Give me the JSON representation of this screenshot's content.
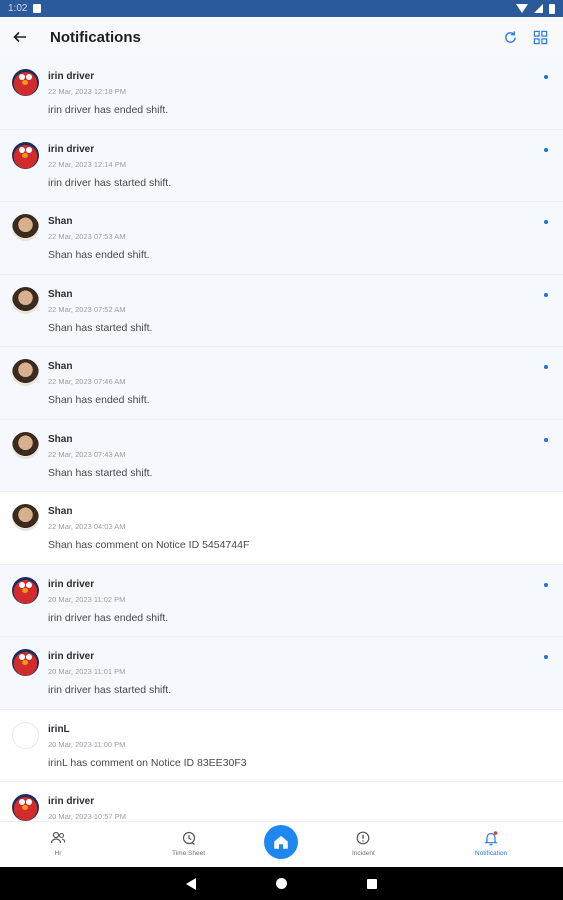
{
  "status_bar": {
    "time": "1:02"
  },
  "app_bar": {
    "title": "Notifications"
  },
  "notifications": [
    {
      "name": "irin driver",
      "date": "22 Mar, 2023 12:18 PM",
      "message": "irin driver has ended shift.",
      "avatar": "elmo",
      "unread": true
    },
    {
      "name": "irin driver",
      "date": "22 Mar, 2023 12:14 PM",
      "message": "irin driver has started shift.",
      "avatar": "elmo",
      "unread": true
    },
    {
      "name": "Shan",
      "date": "22 Mar, 2023 07:53 AM",
      "message": "Shan has ended shift.",
      "avatar": "shan",
      "unread": true
    },
    {
      "name": "Shan",
      "date": "22 Mar, 2023 07:52 AM",
      "message": "Shan has started shift.",
      "avatar": "shan",
      "unread": true
    },
    {
      "name": "Shan",
      "date": "22 Mar, 2023 07:46 AM",
      "message": "Shan has ended shift.",
      "avatar": "shan",
      "unread": true
    },
    {
      "name": "Shan",
      "date": "22 Mar, 2023 07:43 AM",
      "message": "Shan has started shift.",
      "avatar": "shan",
      "unread": true
    },
    {
      "name": "Shan",
      "date": "22 Mar, 2023 04:03 AM",
      "message": "Shan has comment on Notice ID 5454744F",
      "avatar": "shan",
      "unread": false
    },
    {
      "name": "irin driver",
      "date": "20 Mar, 2023 11:02 PM",
      "message": "irin driver has ended shift.",
      "avatar": "elmo",
      "unread": true
    },
    {
      "name": "irin driver",
      "date": "20 Mar, 2023 11:01 PM",
      "message": "irin driver has started shift.",
      "avatar": "elmo",
      "unread": true
    },
    {
      "name": "irinL",
      "date": "20 Mar, 2023 11:00 PM",
      "message": "irinL has comment on Notice ID 83EE30F3",
      "avatar": "blank",
      "unread": false
    },
    {
      "name": "irin driver",
      "date": "20 Mar, 2023 10:57 PM",
      "message": "",
      "avatar": "elmo",
      "unread": false
    }
  ],
  "bottom_nav": {
    "items": [
      {
        "label": "Hr",
        "icon": "users-icon"
      },
      {
        "label": "Time Sheet",
        "icon": "timesheet-icon"
      },
      {
        "label": "Incident",
        "icon": "incident-icon"
      },
      {
        "label": "Notification",
        "icon": "bell-icon",
        "active": true
      }
    ]
  },
  "colors": {
    "accent": "#1e88f0",
    "unread_dot": "#1f6fe0",
    "status_bar": "#2a5a9a"
  }
}
